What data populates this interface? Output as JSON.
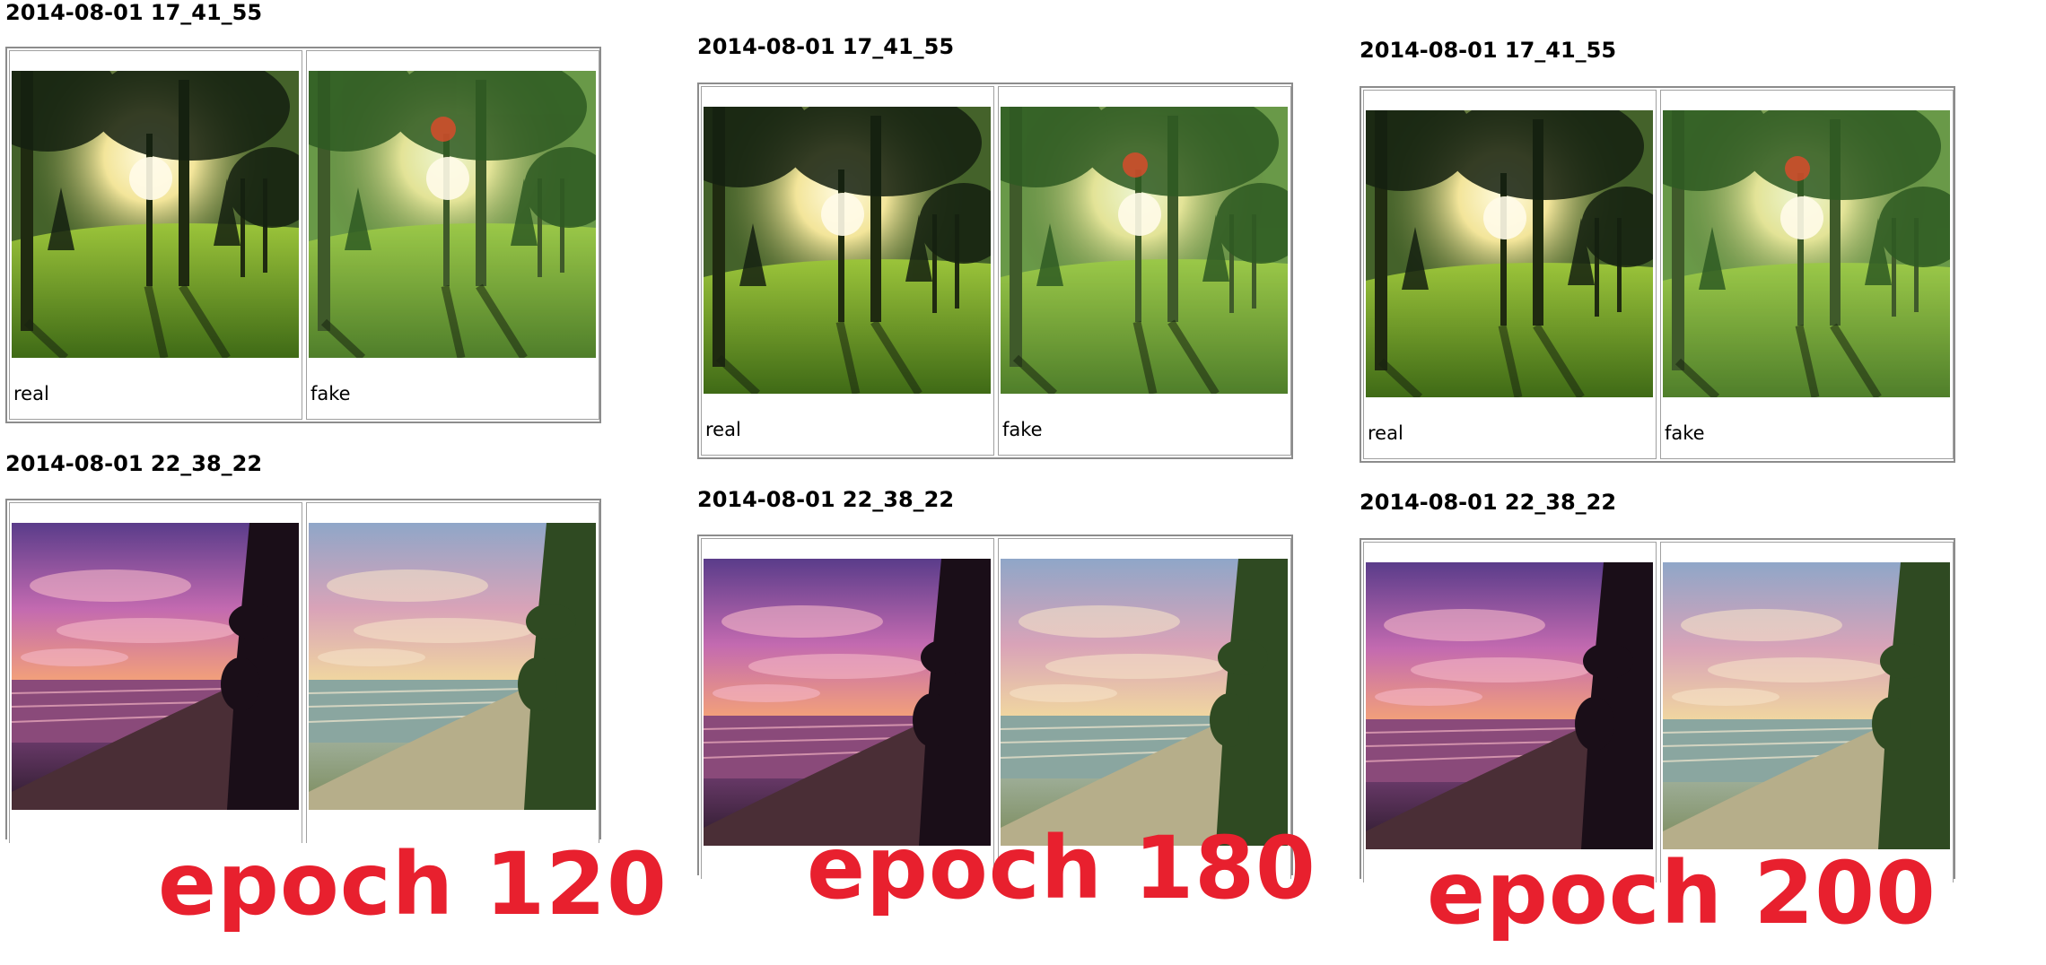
{
  "panels": [
    {
      "rows": [
        {
          "timestamp": "2014-08-01 17_41_55",
          "real_label": "real",
          "fake_label": "fake",
          "scene": "forest-sunrise"
        },
        {
          "timestamp": "2014-08-01 22_38_22",
          "scene": "beach-sunset"
        }
      ],
      "epoch_label": "epoch 120"
    },
    {
      "rows": [
        {
          "timestamp": "2014-08-01 17_41_55",
          "real_label": "real",
          "fake_label": "fake",
          "scene": "forest-sunrise"
        },
        {
          "timestamp": "2014-08-01 22_38_22",
          "scene": "beach-sunset"
        }
      ],
      "epoch_label": "epoch 180"
    },
    {
      "rows": [
        {
          "timestamp": "2014-08-01 17_41_55",
          "real_label": "real",
          "fake_label": "fake",
          "scene": "forest-sunrise"
        },
        {
          "timestamp": "2014-08-01 22_38_22",
          "scene": "beach-sunset"
        }
      ],
      "epoch_label": "epoch 200"
    }
  ],
  "colors": {
    "epoch_text": "#e8202e",
    "table_border": "#8c8c8c"
  }
}
